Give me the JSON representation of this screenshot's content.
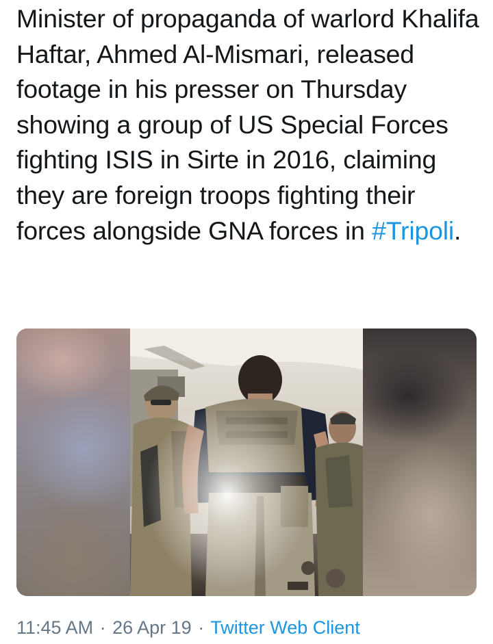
{
  "tweet": {
    "text": "Minister of propaganda of warlord Khalifa Haftar, Ahmed Al-Mismari, released footage in his presser on Thursday showing a group of US Special Forces fighting ISIS in Sirte in 2016, claiming they are foreign troops fighting their forces alongside GNA forces in ",
    "hashtag": "#Tripoli",
    "text_end": ".",
    "hashtag_color": "#1b95e0",
    "text_color": "#14171a"
  },
  "media": {
    "kind": "video-thumbnail"
  },
  "meta": {
    "time": "11:45 AM",
    "separator": "·",
    "date": "26 Apr 19",
    "client": "Twitter Web Client",
    "meta_color": "#657786",
    "link_color": "#1b95e0"
  }
}
